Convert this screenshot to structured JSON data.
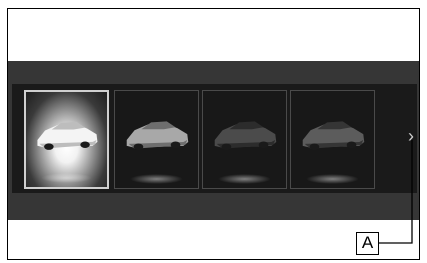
{
  "carousel": {
    "items": [
      {
        "name": "car-color-1",
        "body_color": "#f4f4f4",
        "shade_color": "#bdbdbd",
        "selected": true
      },
      {
        "name": "car-color-2",
        "body_color": "#a8a8a8",
        "shade_color": "#6e6e6e",
        "selected": false
      },
      {
        "name": "car-color-3",
        "body_color": "#4b4b4b",
        "shade_color": "#2c2c2c",
        "selected": false
      },
      {
        "name": "car-color-4",
        "body_color": "#5c5c5c",
        "shade_color": "#353535",
        "selected": false
      }
    ],
    "next_icon": "chevron-right-icon",
    "next_glyph": "›"
  },
  "callout": {
    "label": "A"
  }
}
